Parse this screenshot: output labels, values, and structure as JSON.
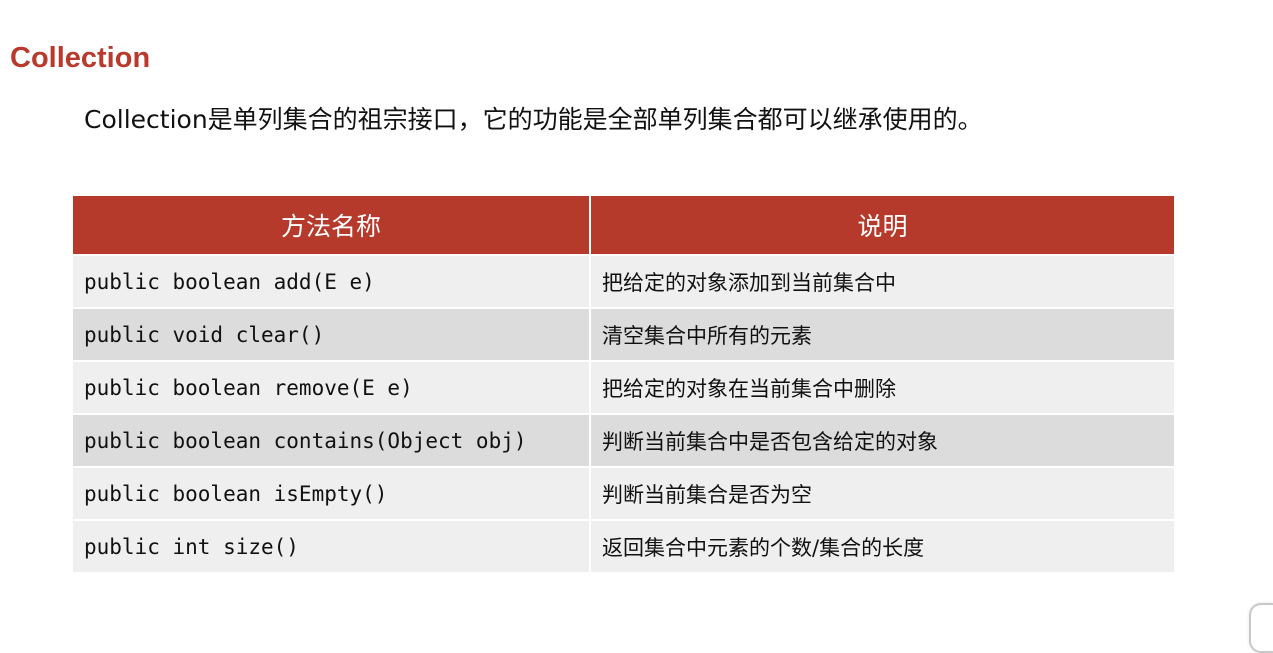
{
  "title": "Collection",
  "intro": "Collection是单列集合的祖宗接口，它的功能是全部单列集合都可以继承使用的。",
  "table": {
    "headers": [
      "方法名称",
      "说明"
    ],
    "rows": [
      {
        "method": "public boolean add(E e)",
        "description": "把给定的对象添加到当前集合中"
      },
      {
        "method": "public void clear()",
        "description": "清空集合中所有的元素"
      },
      {
        "method": "public boolean remove(E e)",
        "description": "把给定的对象在当前集合中删除"
      },
      {
        "method": "public boolean contains(Object obj)",
        "description": "判断当前集合中是否包含给定的对象"
      },
      {
        "method": "public boolean isEmpty()",
        "description": "判断当前集合是否为空"
      },
      {
        "method": "public int size()",
        "description": "返回集合中元素的个数/集合的长度"
      }
    ]
  },
  "colors": {
    "accent": "#b53a2b",
    "row_light": "#efefef",
    "row_dark": "#dcdcdc"
  }
}
